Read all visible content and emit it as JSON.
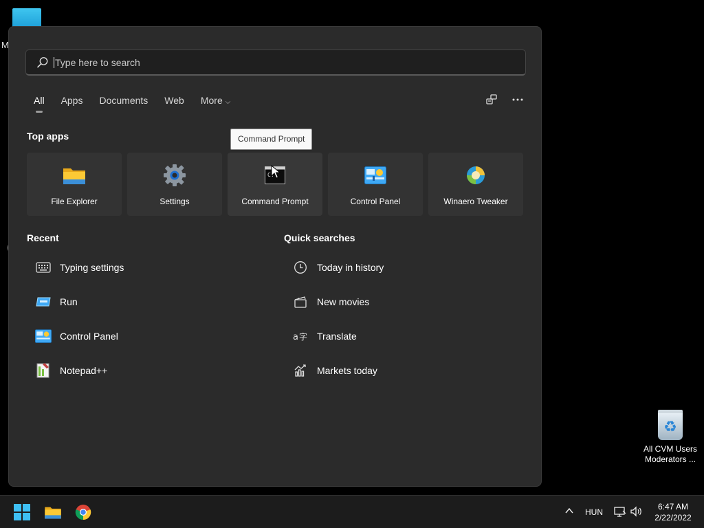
{
  "desktop": {
    "partial_text_top": "M",
    "partial_text_mid": "(",
    "recycle_label_line1": "All CVM Users",
    "recycle_label_line2": "Moderators ..."
  },
  "search": {
    "placeholder": "Type here to search",
    "value": ""
  },
  "tabs": [
    {
      "label": "All",
      "active": true
    },
    {
      "label": "Apps"
    },
    {
      "label": "Documents"
    },
    {
      "label": "Web"
    },
    {
      "label": "More"
    }
  ],
  "tabs_right_icons": [
    "share-icon",
    "more-options-icon"
  ],
  "top_apps": {
    "title": "Top apps",
    "items": [
      {
        "label": "File Explorer",
        "icon": "folder-icon"
      },
      {
        "label": "Settings",
        "icon": "gear-icon"
      },
      {
        "label": "Command Prompt",
        "icon": "terminal-icon"
      },
      {
        "label": "Control Panel",
        "icon": "control-panel-icon"
      },
      {
        "label": "Winaero Tweaker",
        "icon": "winaero-icon"
      }
    ],
    "tooltip": "Command Prompt"
  },
  "recent": {
    "title": "Recent",
    "items": [
      {
        "label": "Typing settings",
        "icon": "keyboard-icon"
      },
      {
        "label": "Run",
        "icon": "run-icon"
      },
      {
        "label": "Control Panel",
        "icon": "control-panel-icon"
      },
      {
        "label": "Notepad++",
        "icon": "notepad-plus-icon"
      }
    ]
  },
  "quick_searches": {
    "title": "Quick searches",
    "items": [
      {
        "label": "Today in history",
        "icon": "clock-icon"
      },
      {
        "label": "New movies",
        "icon": "clapperboard-icon"
      },
      {
        "label": "Translate",
        "icon": "translate-icon"
      },
      {
        "label": "Markets today",
        "icon": "chart-icon"
      }
    ]
  },
  "taskbar": {
    "language": "HUN",
    "time": "6:47 AM",
    "date": "2/22/2022"
  },
  "colors": {
    "panel": "#2b2b2b",
    "accent": "#3fa9f5",
    "taskbar": "#1c1c1c"
  }
}
